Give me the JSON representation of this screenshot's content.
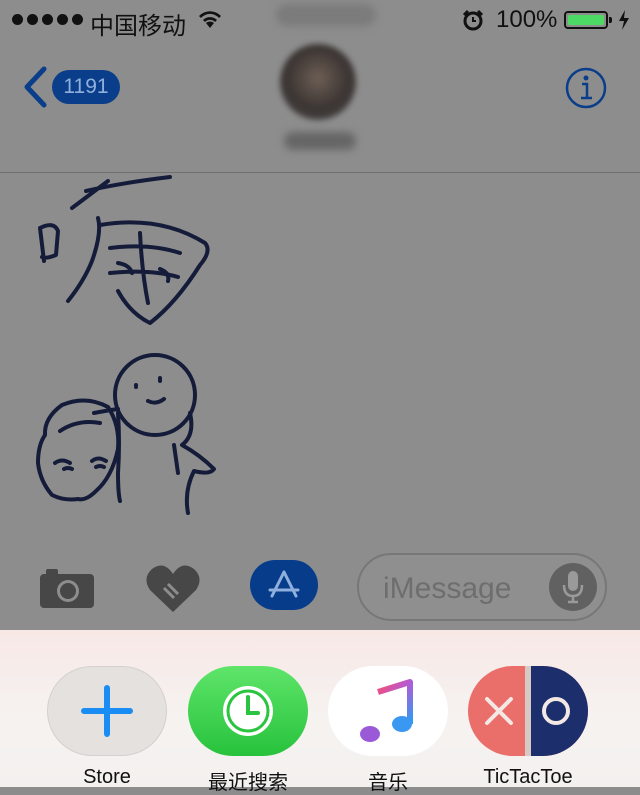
{
  "status_bar": {
    "carrier": "中国移动",
    "battery_percent": "100%",
    "battery_level": 1.0
  },
  "nav": {
    "back_count": "1191"
  },
  "composer": {
    "placeholder": "iMessage"
  },
  "drawer": {
    "apps": [
      {
        "label": "Store",
        "icon": "plus-icon"
      },
      {
        "label": "最近搜索",
        "icon": "clock-icon"
      },
      {
        "label": "音乐",
        "icon": "music-note-icon"
      },
      {
        "label": "TicTacToe",
        "icon": "tictactoe-icon"
      }
    ]
  },
  "colors": {
    "ios_blue": "#0a3e8a",
    "battery_green": "#4cd964",
    "dim_overlay": "#8d8d8d",
    "drawer_bg": "#f6f2f0"
  }
}
